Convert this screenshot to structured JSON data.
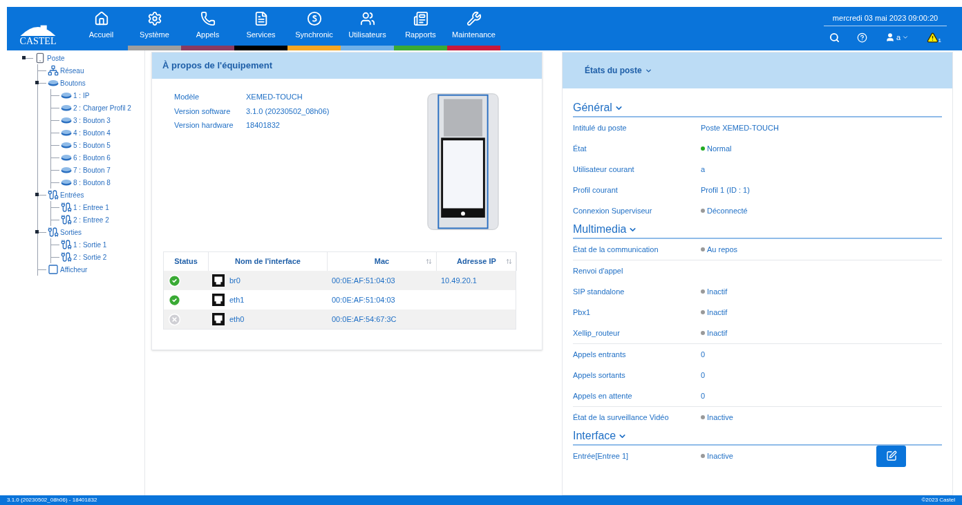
{
  "header": {
    "logo": "CASTEL",
    "nav": [
      {
        "label": "Accueil"
      },
      {
        "label": "Système",
        "color": "#9e9e9e"
      },
      {
        "label": "Appels",
        "color": "#8a3a60"
      },
      {
        "label": "Services",
        "color": "#000000"
      },
      {
        "label": "Synchronic",
        "color": "#f5a623"
      },
      {
        "label": "Utilisateurs",
        "color": "#6fb0e8"
      },
      {
        "label": "Rapports",
        "color": "#3aaa35"
      },
      {
        "label": "Maintenance",
        "color": "#c8193c"
      }
    ],
    "datetime": "mercredi 03 mai 2023 09:00:20",
    "user": "a",
    "alert_count": "1"
  },
  "tree": [
    {
      "label": "Poste",
      "kind": "device",
      "expanded": true,
      "children": [
        {
          "label": "Réseau",
          "kind": "network"
        },
        {
          "label": "Boutons",
          "kind": "button",
          "expanded": true,
          "children": [
            {
              "label": "1 : IP",
              "kind": "button"
            },
            {
              "label": "2 : Charger Profil 2",
              "kind": "button"
            },
            {
              "label": "3 : Bouton 3",
              "kind": "button"
            },
            {
              "label": "4 : Bouton 4",
              "kind": "button"
            },
            {
              "label": "5 : Bouton 5",
              "kind": "button"
            },
            {
              "label": "6 : Bouton 6",
              "kind": "button"
            },
            {
              "label": "7 : Bouton 7",
              "kind": "button"
            },
            {
              "label": "8 : Bouton 8",
              "kind": "button"
            }
          ]
        },
        {
          "label": "Entrées",
          "kind": "input",
          "expanded": true,
          "children": [
            {
              "label": "1 : Entree 1",
              "kind": "input"
            },
            {
              "label": "2 : Entree 2",
              "kind": "input"
            }
          ]
        },
        {
          "label": "Sorties",
          "kind": "output",
          "expanded": true,
          "children": [
            {
              "label": "1 : Sortie 1",
              "kind": "output"
            },
            {
              "label": "2 : Sortie 2",
              "kind": "output"
            }
          ]
        },
        {
          "label": "Afficheur",
          "kind": "display"
        }
      ]
    }
  ],
  "about": {
    "title": "À propos de l'équipement",
    "info": [
      {
        "label": "Modèle",
        "value": "XEMED-TOUCH"
      },
      {
        "label": "Version software",
        "value": "3.1.0 (20230502_08h06)"
      },
      {
        "label": "Version hardware",
        "value": "18401832"
      }
    ],
    "table": {
      "columns": [
        {
          "label": "Status",
          "sortable": false
        },
        {
          "label": "Nom de l'interface",
          "sortable": false
        },
        {
          "label": "Mac",
          "sortable": true
        },
        {
          "label": "Adresse IP",
          "sortable": true
        }
      ],
      "rows": [
        {
          "connected": true,
          "name": "br0",
          "mac": "00:0E:AF:51:04:03",
          "ip": "10.49.20.1"
        },
        {
          "connected": true,
          "name": "eth1",
          "mac": "00:0E:AF:51:04:03"
        },
        {
          "connected": false,
          "name": "eth0",
          "mac": "00:0E:AF:54:67:3C"
        }
      ]
    }
  },
  "states": {
    "title": "États du poste",
    "sections": [
      {
        "title": "Général",
        "groups": [
          [
            {
              "label": "Intitulé du poste",
              "value": "Poste XEMED-TOUCH"
            },
            {
              "label": "État",
              "value": "Normal",
              "color": "#22aa22"
            },
            {
              "label": "Utilisateur courant",
              "value": "a"
            },
            {
              "label": "Profil courant",
              "value": "Profil 1 (ID : 1)"
            },
            {
              "label": "Connexion Superviseur",
              "value": "Déconnecté",
              "color": "#999999"
            }
          ]
        ]
      },
      {
        "title": "Multimedia",
        "groups": [
          [
            {
              "label": "État de la communication",
              "value": "Au repos",
              "color": "#999999"
            }
          ],
          [
            {
              "label": "Renvoi d'appel"
            },
            {
              "label": "SIP standalone",
              "value": "Inactif",
              "color": "#999999"
            },
            {
              "label": "Pbx1",
              "value": "Inactif",
              "color": "#999999"
            },
            {
              "label": "Xellip_routeur",
              "value": "Inactif",
              "color": "#999999"
            }
          ],
          [
            {
              "label": "Appels entrants",
              "value": "0"
            },
            {
              "label": "Appels sortants",
              "value": "0"
            },
            {
              "label": "Appels en attente",
              "value": "0"
            }
          ],
          [
            {
              "label": "État de la surveillance Vidéo",
              "value": "Inactive",
              "color": "#999999"
            }
          ]
        ]
      },
      {
        "title": "Interface",
        "groups": [
          [
            {
              "label": "Entrée[Entree 1]",
              "value": "Inactive",
              "color": "#999999",
              "edit_button": true
            }
          ]
        ]
      }
    ]
  },
  "footer": {
    "left": "3.1.0 (20230502_08h06) - 18401832",
    "right": "©2023 Castel"
  }
}
